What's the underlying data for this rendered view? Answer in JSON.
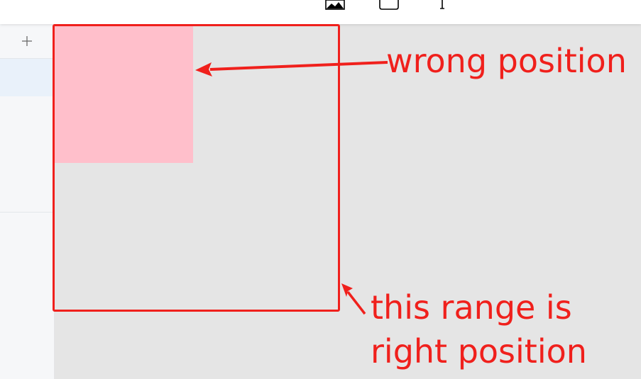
{
  "toolbar": {
    "tools": [
      {
        "name": "image-tool",
        "icon": "image-icon"
      },
      {
        "name": "rectangle-tool",
        "icon": "rectangle-icon"
      },
      {
        "name": "text-tool",
        "icon": "text-icon"
      }
    ]
  },
  "sidebar": {
    "add_icon": "plus-icon"
  },
  "annotations": {
    "wrong_label": "wrong position",
    "right_label_line1": "this range is",
    "right_label_line2": "right position"
  },
  "colors": {
    "annotation": "#f0201c",
    "canvas": "#e5e5e5",
    "pink_shape": "#ffbfcb",
    "sidebar_active": "#e9f1fa"
  }
}
